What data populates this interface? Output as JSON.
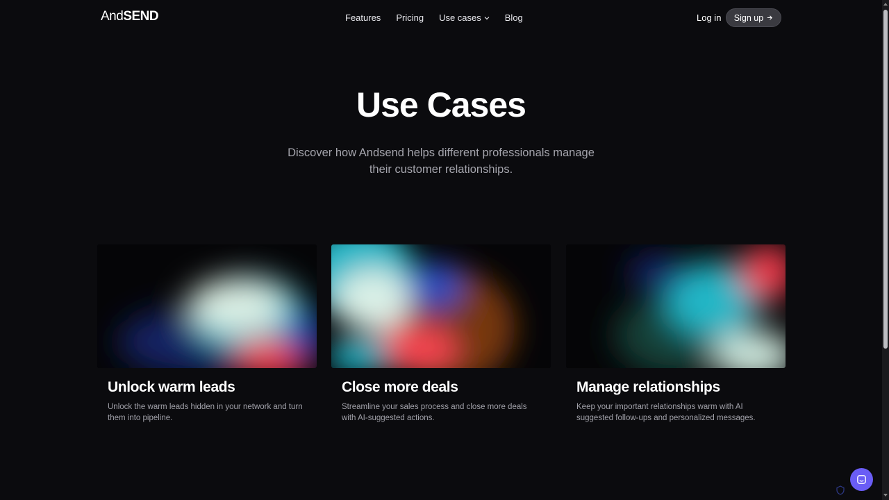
{
  "header": {
    "logo_thin": "And",
    "logo_bold": "SEND",
    "nav": [
      "Features",
      "Pricing",
      "Use cases",
      "Blog"
    ],
    "login": "Log in",
    "signup": "Sign up"
  },
  "hero": {
    "title": "Use Cases",
    "subtitle": "Discover how Andsend helps different professionals manage their customer relationships."
  },
  "cards": [
    {
      "title": "Unlock warm leads",
      "desc": "Unlock the warm leads hidden in your network and turn them into pipeline."
    },
    {
      "title": "Close more deals",
      "desc": "Streamline your sales process and close more deals with AI-suggested actions."
    },
    {
      "title": "Manage relationships",
      "desc": "Keep your important relationships warm with AI suggested follow-ups and personalized messages."
    }
  ],
  "icons": {
    "chevron": "chevron-down-icon",
    "arrow": "arrow-right-icon",
    "chat": "chat-icon"
  },
  "colors": {
    "background": "#0b0b0e",
    "chat_accent": "#6a5df5",
    "signup_bg": "#3a3a40"
  }
}
